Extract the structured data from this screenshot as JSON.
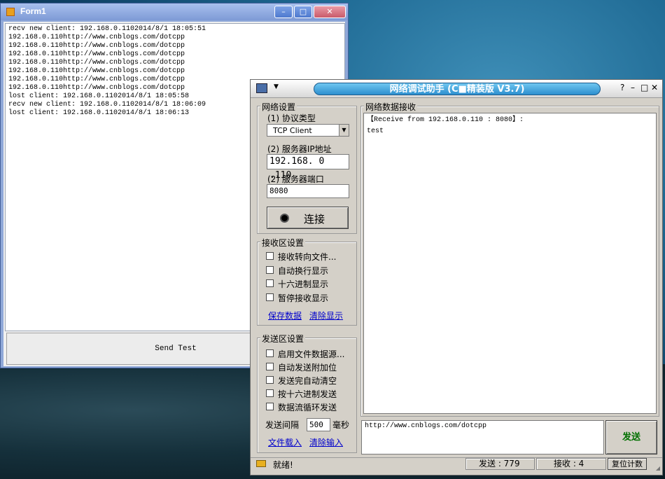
{
  "form1": {
    "title": "Form1",
    "controls": {
      "min": "–",
      "max": "□",
      "close": "✕"
    },
    "log_lines": [
      "recv new client: 192.168.0.1102014/8/1 18:05:51",
      "192.168.0.110http://www.cnblogs.com/dotcpp",
      "192.168.0.110http://www.cnblogs.com/dotcpp",
      "192.168.0.110http://www.cnblogs.com/dotcpp",
      "192.168.0.110http://www.cnblogs.com/dotcpp",
      "192.168.0.110http://www.cnblogs.com/dotcpp",
      "192.168.0.110http://www.cnblogs.com/dotcpp",
      "192.168.0.110http://www.cnblogs.com/dotcpp",
      "lost client: 192.168.0.1102014/8/1 18:05:58",
      "recv new client: 192.168.0.1102014/8/1 18:06:09",
      "lost client: 192.168.0.1102014/8/1 18:06:13"
    ],
    "send_button": "Send Test"
  },
  "net": {
    "title": "网络调试助手 (C■精装版 V3.7)",
    "window_controls": {
      "help": "?",
      "min": "–",
      "max": "□",
      "close": "✕"
    },
    "sys_menu_caret": "▼",
    "network": {
      "legend": "网络设置",
      "protocol_label": "(1) 协议类型",
      "protocol_value": "TCP Client",
      "ip_label": "(2) 服务器IP地址",
      "ip_value": "192.168. 0 .110",
      "port_label": "(2) 服务器端口",
      "port_value": "8080",
      "connect": "连接"
    },
    "receive_settings": {
      "legend": "接收区设置",
      "options": [
        "接收转向文件...",
        "自动换行显示",
        "十六进制显示",
        "暂停接收显示"
      ],
      "save_link": "保存数据",
      "clear_link": "清除显示"
    },
    "send_settings": {
      "legend": "发送区设置",
      "options": [
        "启用文件数据源...",
        "自动发送附加位",
        "发送完自动清空",
        "按十六进制发送",
        "数据流循环发送"
      ],
      "interval_label": "发送间隔",
      "interval_value": "500",
      "interval_unit": "毫秒",
      "load_link": "文件载入",
      "clear_link": "清除输入"
    },
    "receive_area": {
      "legend": "网络数据接收",
      "lines": [
        "【Receive from 192.168.0.110 : 8080】:",
        "test"
      ]
    },
    "send_text": "http://www.cnblogs.com/dotcpp",
    "send_button": "发送",
    "status": {
      "ready": "就绪!",
      "sent": "发送 : 779",
      "received": "接收 : 4",
      "reset": "复位计数"
    }
  }
}
